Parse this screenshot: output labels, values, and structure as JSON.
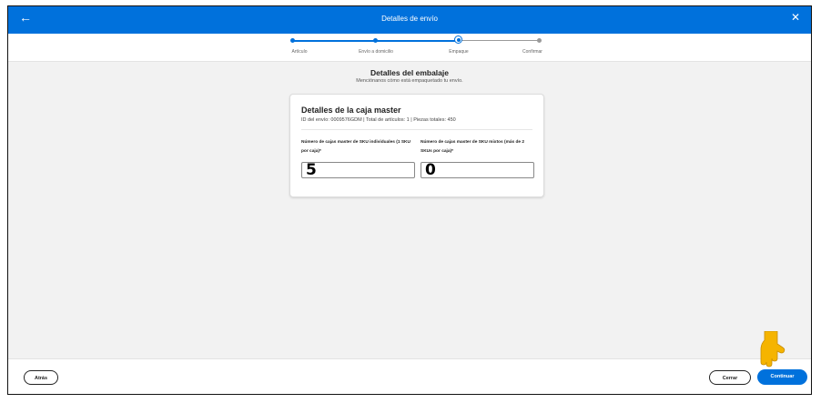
{
  "window": {
    "title": "Detalles de envío"
  },
  "stepper": {
    "steps": [
      {
        "label": "Artículo",
        "state": "done"
      },
      {
        "label": "Envío a domicilio",
        "state": "done"
      },
      {
        "label": "Empaque",
        "state": "current"
      },
      {
        "label": "Confirmar",
        "state": "pending"
      }
    ]
  },
  "main": {
    "heading": "Detalles del embalaje",
    "subheading": "Menciónanos cómo está empaquetado tu envío."
  },
  "card": {
    "title": "Detalles de la caja master",
    "meta": "ID del envío: 0009576GDM | Total de artículos: 1 | Piezas totales: 450",
    "individual": {
      "label": "Número de cajas master de SKU individuales (1 SKU por caja)*",
      "value": "5"
    },
    "mixed": {
      "label": "Número de cajas master de SKU mixtos (más de 2 SKUs por caja)*",
      "value": "0"
    }
  },
  "footer": {
    "back_label": "Atrás",
    "close_label": "Cerrar",
    "continue_label": "Continuar"
  },
  "colors": {
    "brand_blue": "#0071dc",
    "pointer_hand": "#f5b400"
  },
  "icons": {
    "back": "arrow-left-icon",
    "close": "close-icon",
    "pointer": "pointing-hand-icon"
  }
}
